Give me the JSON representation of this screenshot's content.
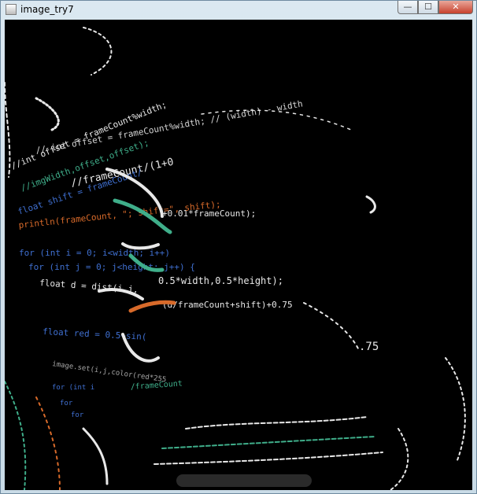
{
  "window": {
    "title": "image_try7",
    "buttons": {
      "minimize": "—",
      "maximize": "☐",
      "close": "✕"
    }
  },
  "colors": {
    "canvas_bg": "#000000",
    "code_white": "#e8e8e8",
    "code_green": "#3fae8a",
    "code_blue": "#3f6fd0",
    "code_orange": "#d86a2a"
  },
  "canvas": {
    "code_fragments": [
      "// int offset = frameCount%width;  //  (width) - width",
      "//int offset = frameCount%width;",
      "//imgWidth,offset,offset);",
      "//frameCount/(1+0",
      "float shift = frameCount/",
      "+0.01*frameCount);",
      "println(frameCount, \"; shift=\", shift);",
      "for (int i = 0; i<width; i++)",
      "for (int j = 0; j<height; j++) {",
      "float d = dist(i,j,",
      "0.5*width,0.5*height);",
      "float red = 0.5+sin(",
      "(d/frameCount+shift)+0.75",
      "/frameCount",
      ".75",
      "image.set(i,j,color(red*255",
      "for (int i",
      "for",
      "for"
    ]
  }
}
